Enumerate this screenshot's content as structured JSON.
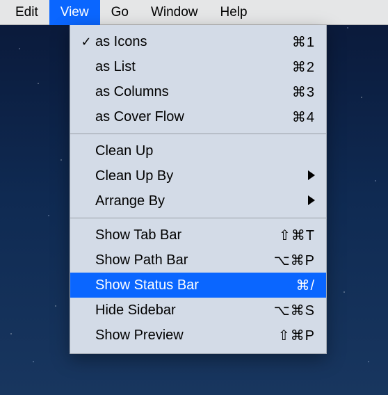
{
  "menubar": {
    "items": [
      {
        "label": "Edit"
      },
      {
        "label": "View"
      },
      {
        "label": "Go"
      },
      {
        "label": "Window"
      },
      {
        "label": "Help"
      }
    ],
    "activeIndex": 1
  },
  "dropdown": {
    "groups": [
      [
        {
          "checked": true,
          "label": "as Icons",
          "shortcut": "⌘1"
        },
        {
          "checked": false,
          "label": "as List",
          "shortcut": "⌘2"
        },
        {
          "checked": false,
          "label": "as Columns",
          "shortcut": "⌘3"
        },
        {
          "checked": false,
          "label": "as Cover Flow",
          "shortcut": "⌘4"
        }
      ],
      [
        {
          "label": "Clean Up"
        },
        {
          "label": "Clean Up By",
          "submenu": true
        },
        {
          "label": "Arrange By",
          "submenu": true
        }
      ],
      [
        {
          "label": "Show Tab Bar",
          "shortcut": "⇧⌘T"
        },
        {
          "label": "Show Path Bar",
          "shortcut": "⌥⌘P"
        },
        {
          "label": "Show Status Bar",
          "shortcut": "⌘/",
          "highlighted": true
        },
        {
          "label": "Hide Sidebar",
          "shortcut": "⌥⌘S"
        },
        {
          "label": "Show Preview",
          "shortcut": "⇧⌘P"
        }
      ]
    ]
  },
  "icons": {
    "check": "✓"
  },
  "colors": {
    "highlight": "#0a66ff",
    "menubar_bg": "#e5e6e7",
    "dropdown_bg": "#d3dbe7"
  }
}
